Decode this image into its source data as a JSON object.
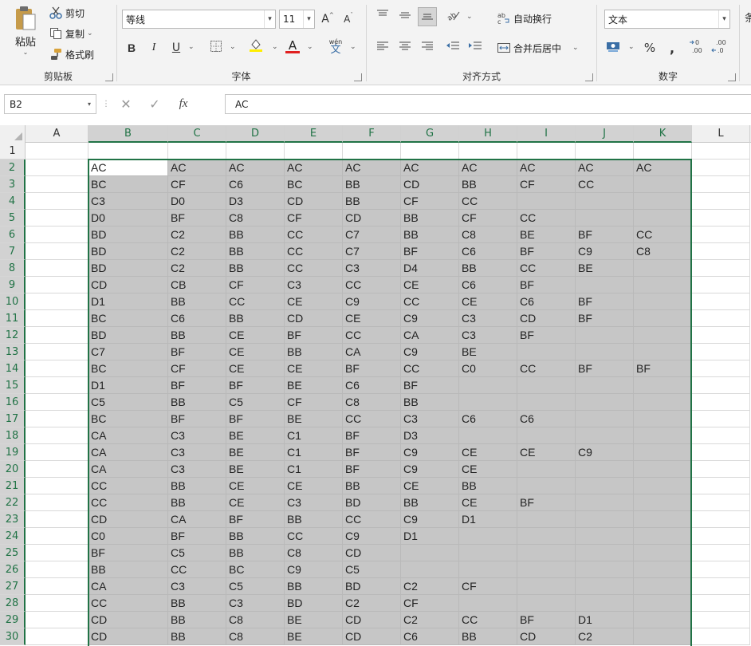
{
  "ribbon": {
    "clipboard": {
      "title": "剪贴板",
      "paste_label": "粘贴",
      "cut_label": "剪切",
      "copy_label": "复制",
      "format_painter_label": "格式刷"
    },
    "font": {
      "title": "字体",
      "font_name": "等线",
      "font_size": "11",
      "bold": "B",
      "italic": "I",
      "underline": "U",
      "grow_font": "A",
      "shrink_font": "A",
      "phonetic": "wén",
      "font_color_mark": "A"
    },
    "alignment": {
      "title": "对齐方式",
      "wrap_text_label": "自动换行",
      "merge_center_label": "合并后居中"
    },
    "number": {
      "title": "数字",
      "format_value": "文本",
      "percent": "%",
      "comma": ","
    }
  },
  "formula_bar": {
    "name_box": "B2",
    "fx_label": "fx",
    "formula_value": "AC"
  },
  "grid": {
    "columns": [
      "A",
      "B",
      "C",
      "D",
      "E",
      "F",
      "G",
      "H",
      "I",
      "J",
      "K",
      "L"
    ],
    "selected_columns": [
      "B",
      "C",
      "D",
      "E",
      "F",
      "G",
      "H",
      "I",
      "J",
      "K"
    ],
    "rows": [
      "1",
      "2",
      "3",
      "4",
      "5",
      "6",
      "7",
      "8",
      "9",
      "10",
      "11",
      "12",
      "13",
      "14",
      "15",
      "16",
      "17",
      "18",
      "19",
      "20",
      "21",
      "22",
      "23",
      "24",
      "25",
      "26",
      "27",
      "28",
      "29",
      "30"
    ],
    "selected_rows_from": 2,
    "active_cell": "B2",
    "data": [
      [
        "AC",
        "AC",
        "AC",
        "AC",
        "AC",
        "AC",
        "AC",
        "AC",
        "AC",
        "AC"
      ],
      [
        "BC",
        "CF",
        "C6",
        "BC",
        "BB",
        "CD",
        "BB",
        "CF",
        "CC",
        ""
      ],
      [
        "C3",
        "D0",
        "D3",
        "CD",
        "BB",
        "CF",
        "CC",
        "",
        "",
        ""
      ],
      [
        "D0",
        "BF",
        "C8",
        "CF",
        "CD",
        "BB",
        "CF",
        "CC",
        "",
        ""
      ],
      [
        "BD",
        "C2",
        "BB",
        "CC",
        "C7",
        "BB",
        "C8",
        "BE",
        "BF",
        "CC"
      ],
      [
        "BD",
        "C2",
        "BB",
        "CC",
        "C7",
        "BF",
        "C6",
        "BF",
        "C9",
        "C8"
      ],
      [
        "BD",
        "C2",
        "BB",
        "CC",
        "C3",
        "D4",
        "BB",
        "CC",
        "BE",
        ""
      ],
      [
        "CD",
        "CB",
        "CF",
        "C3",
        "CC",
        "CE",
        "C6",
        "BF",
        "",
        ""
      ],
      [
        "D1",
        "BB",
        "CC",
        "CE",
        "C9",
        "CC",
        "CE",
        "C6",
        "BF",
        ""
      ],
      [
        "BC",
        "C6",
        "BB",
        "CD",
        "CE",
        "C9",
        "C3",
        "CD",
        "BF",
        ""
      ],
      [
        "BD",
        "BB",
        "CE",
        "BF",
        "CC",
        "CA",
        "C3",
        "BF",
        "",
        ""
      ],
      [
        "C7",
        "BF",
        "CE",
        "BB",
        "CA",
        "C9",
        "BE",
        "",
        "",
        ""
      ],
      [
        "BC",
        "CF",
        "CE",
        "CE",
        "BF",
        "CC",
        "C0",
        "CC",
        "BF",
        "BF"
      ],
      [
        "D1",
        "BF",
        "BF",
        "BE",
        "C6",
        "BF",
        "",
        "",
        "",
        ""
      ],
      [
        "C5",
        "BB",
        "C5",
        "CF",
        "C8",
        "BB",
        "",
        "",
        "",
        ""
      ],
      [
        "BC",
        "BF",
        "BF",
        "BE",
        "CC",
        "C3",
        "C6",
        "C6",
        "",
        ""
      ],
      [
        "CA",
        "C3",
        "BE",
        "C1",
        "BF",
        "D3",
        "",
        "",
        "",
        ""
      ],
      [
        "CA",
        "C3",
        "BE",
        "C1",
        "BF",
        "C9",
        "CE",
        "CE",
        "C9",
        ""
      ],
      [
        "CA",
        "C3",
        "BE",
        "C1",
        "BF",
        "C9",
        "CE",
        "",
        "",
        ""
      ],
      [
        "CC",
        "BB",
        "CE",
        "CE",
        "BB",
        "CE",
        "BB",
        "",
        "",
        ""
      ],
      [
        "CC",
        "BB",
        "CE",
        "C3",
        "BD",
        "BB",
        "CE",
        "BF",
        "",
        ""
      ],
      [
        "CD",
        "CA",
        "BF",
        "BB",
        "CC",
        "C9",
        "D1",
        "",
        "",
        ""
      ],
      [
        "C0",
        "BF",
        "BB",
        "CC",
        "C9",
        "D1",
        "",
        "",
        "",
        ""
      ],
      [
        "BF",
        "C5",
        "BB",
        "C8",
        "CD",
        "",
        "",
        "",
        "",
        ""
      ],
      [
        "BB",
        "CC",
        "BC",
        "C9",
        "C5",
        "",
        "",
        "",
        "",
        ""
      ],
      [
        "CA",
        "C3",
        "C5",
        "BB",
        "BD",
        "C2",
        "CF",
        "",
        "",
        ""
      ],
      [
        "CC",
        "BB",
        "C3",
        "BD",
        "C2",
        "CF",
        "",
        "",
        "",
        ""
      ],
      [
        "CD",
        "BB",
        "C8",
        "BE",
        "CD",
        "C2",
        "CC",
        "BF",
        "D1",
        ""
      ],
      [
        "CD",
        "BB",
        "C8",
        "BE",
        "CD",
        "C6",
        "BB",
        "CD",
        "C2",
        ""
      ]
    ]
  },
  "colors": {
    "accent": "#217346",
    "selection_fill": "#c6c6c6",
    "ribbon_bg": "#f3f3f3",
    "font_color_bar": "#e02020",
    "highlight_bar": "#ffee00"
  },
  "icons": [
    "paste-icon",
    "cut-icon",
    "copy-icon",
    "format-painter-icon",
    "border-icon",
    "fill-color-icon",
    "font-color-icon",
    "phonetic-icon",
    "align-top-icon",
    "align-middle-icon",
    "align-bottom-icon",
    "orientation-icon",
    "wrap-text-icon",
    "align-left-icon",
    "align-center-icon",
    "align-right-icon",
    "decrease-indent-icon",
    "increase-indent-icon",
    "merge-center-icon",
    "currency-icon",
    "increase-decimal-icon",
    "decrease-decimal-icon",
    "cancel-icon",
    "enter-icon",
    "corner-triangle-icon"
  ]
}
